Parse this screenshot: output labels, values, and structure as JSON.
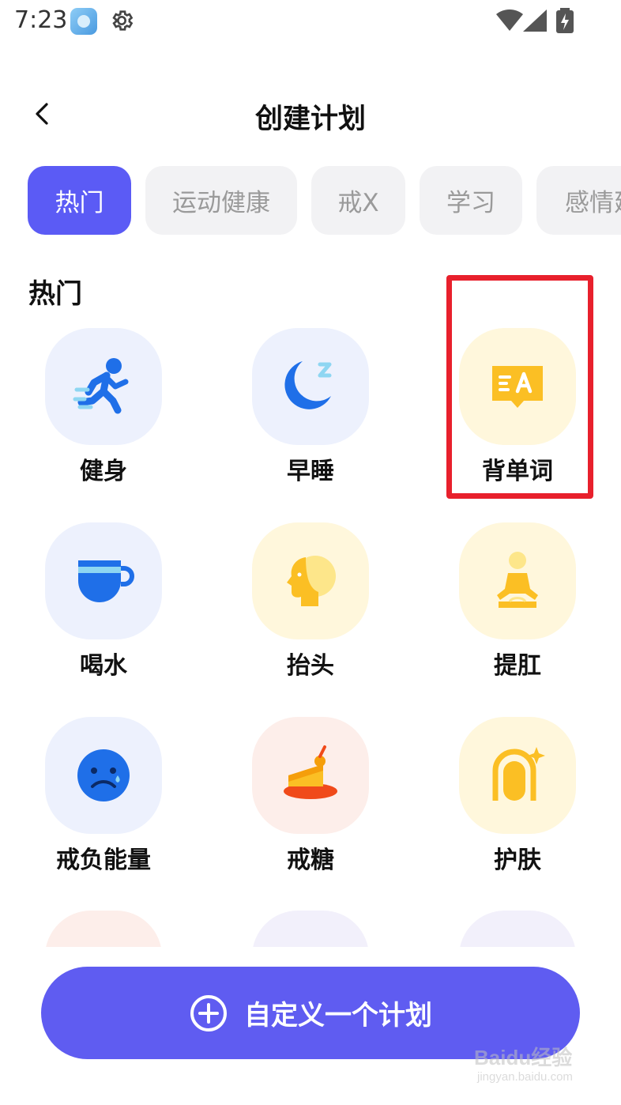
{
  "status_bar": {
    "time": "7:23",
    "icons": [
      "app-icon",
      "gear-icon",
      "wifi-icon",
      "signal-icon",
      "battery-charging-icon"
    ]
  },
  "header": {
    "back_icon": "chevron-left-icon",
    "title": "创建计划"
  },
  "tabs": [
    {
      "label": "热门",
      "active": true
    },
    {
      "label": "运动健康",
      "active": false
    },
    {
      "label": "戒X",
      "active": false
    },
    {
      "label": "学习",
      "active": false
    },
    {
      "label": "感情建",
      "active": false
    }
  ],
  "section": {
    "title": "热门",
    "items": [
      {
        "label": "健身",
        "icon": "running-person-icon",
        "bg": "blue"
      },
      {
        "label": "早睡",
        "icon": "moon-sleep-icon",
        "bg": "blue"
      },
      {
        "label": "背单词",
        "icon": "word-card-icon",
        "bg": "yellow"
      },
      {
        "label": "喝水",
        "icon": "cup-icon",
        "bg": "blue"
      },
      {
        "label": "抬头",
        "icon": "head-profile-icon",
        "bg": "yellow"
      },
      {
        "label": "提肛",
        "icon": "meditation-icon",
        "bg": "yellow"
      },
      {
        "label": "戒负能量",
        "icon": "sad-face-icon",
        "bg": "blue"
      },
      {
        "label": "戒糖",
        "icon": "cake-icon",
        "bg": "pink"
      },
      {
        "label": "护肤",
        "icon": "face-sparkle-icon",
        "bg": "yellow"
      }
    ]
  },
  "custom_plan_button": {
    "icon": "plus-circle-icon",
    "label": "自定义一个计划"
  },
  "highlight": {
    "target": "背单词",
    "color": "#e8202c"
  },
  "colors": {
    "accent": "#5f5cf1",
    "tab_active": "#5b5bf5",
    "tab_inactive_bg": "#f2f2f4",
    "icon_blue": "#1f6fe8",
    "icon_yellow": "#fbbf24"
  },
  "watermark": {
    "brand": "Baidu经验",
    "url": "jingyan.baidu.com"
  }
}
